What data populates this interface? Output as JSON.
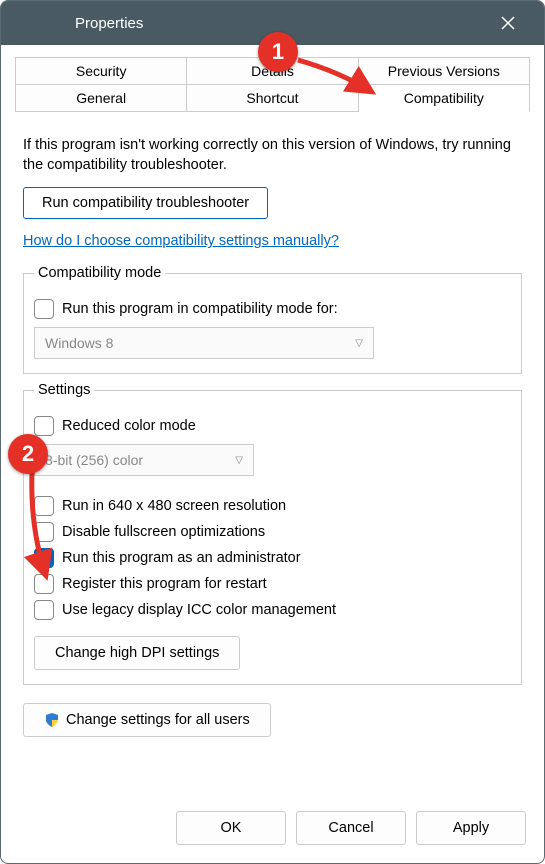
{
  "window": {
    "title": "Properties"
  },
  "tabs": {
    "row1": [
      "Security",
      "Details",
      "Previous Versions"
    ],
    "row2": [
      "General",
      "Shortcut",
      "Compatibility"
    ],
    "active": "Compatibility"
  },
  "description": "If this program isn't working correctly on this version of Windows, try running the compatibility troubleshooter.",
  "troubleshoot_btn": "Run compatibility troubleshooter",
  "manual_link": "How do I choose compatibility settings manually?",
  "compat_mode": {
    "legend": "Compatibility mode",
    "checkbox_label": "Run this program in compatibility mode for:",
    "select_value": "Windows 8"
  },
  "settings": {
    "legend": "Settings",
    "reduced_color": "Reduced color mode",
    "color_select": "8-bit (256) color",
    "run_640": "Run in 640 x 480 screen resolution",
    "disable_fullscreen": "Disable fullscreen optimizations",
    "run_admin": "Run this program as an administrator",
    "register_restart": "Register this program for restart",
    "use_legacy_icc": "Use legacy display ICC color management",
    "dpi_btn": "Change high DPI settings"
  },
  "all_users_btn": "Change settings for all users",
  "footer": {
    "ok": "OK",
    "cancel": "Cancel",
    "apply": "Apply"
  },
  "annotations": {
    "badge1": "1",
    "badge2": "2"
  }
}
